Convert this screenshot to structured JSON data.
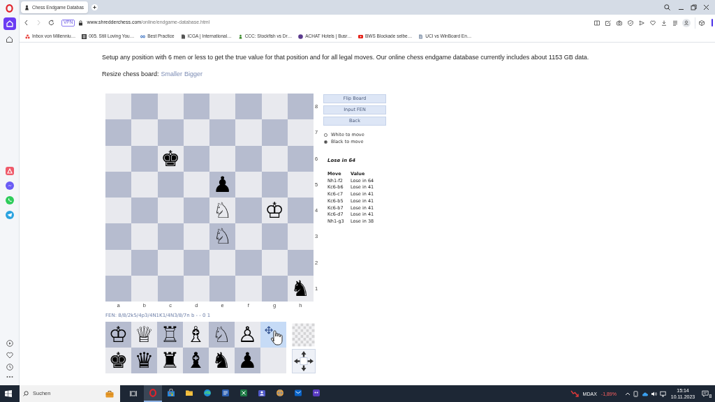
{
  "browser": {
    "tabs": [
      {
        "title": "Chess Endgame Databas",
        "selected": true
      }
    ],
    "address_bar": {
      "vpn_badge": "VPN",
      "url_host": "www.shredderchess.com",
      "url_path": "/online/endgame-database.html"
    },
    "bookmarks": [
      "Inbox von Millenniu…",
      "005. Still Loving You…",
      "Best Practice",
      "ICGA | International…",
      "CCC: Stockfish vs Dr…",
      "ACHAT Hotels | Busr…",
      "BWS Blockade selbe…",
      "UCI vs WinBoard En…"
    ]
  },
  "page": {
    "intro": "Setup any position with 6 men or less to get the true value for that position and for all legal moves. Our online chess endgame database currently includes about 1153 GB data.",
    "resize_label": "Resize chess board:",
    "resize_links": [
      "Smaller",
      "Bigger"
    ],
    "board": {
      "rows": [
        [
          null,
          null,
          null,
          null,
          null,
          null,
          null,
          null
        ],
        [
          null,
          null,
          null,
          null,
          null,
          null,
          null,
          null
        ],
        [
          null,
          null,
          {
            "piece": "♚"
          },
          null,
          null,
          null,
          null,
          null
        ],
        [
          null,
          null,
          null,
          null,
          {
            "piece": "♟"
          },
          null,
          null,
          null
        ],
        [
          null,
          null,
          null,
          null,
          {
            "piece": "♘"
          },
          null,
          {
            "piece": "♔"
          },
          null
        ],
        [
          null,
          null,
          null,
          null,
          {
            "piece": "♘"
          },
          null,
          null,
          null
        ],
        [
          null,
          null,
          null,
          null,
          null,
          null,
          null,
          null
        ],
        [
          null,
          null,
          null,
          null,
          null,
          null,
          null,
          {
            "piece": "♞"
          }
        ]
      ],
      "rank_labels": [
        "8",
        "7",
        "6",
        "5",
        "4",
        "3",
        "2",
        "1"
      ],
      "file_labels": [
        "a",
        "b",
        "c",
        "d",
        "e",
        "f",
        "g",
        "h"
      ]
    },
    "buttons": [
      "Flip Board",
      "Input FEN",
      "Back"
    ],
    "side_to_move": [
      {
        "label": "White to move",
        "selected": false
      },
      {
        "label": "Black to move",
        "selected": true
      }
    ],
    "result": "Lose in 64",
    "moves_table": {
      "columns": [
        "Move",
        "Value"
      ],
      "rows": [
        {
          "move": "Nh1-f2",
          "value": "Lose in 64"
        },
        {
          "move": "Kc6-b6",
          "value": "Lose in 41"
        },
        {
          "move": "Kc6-c7",
          "value": "Lose in 41"
        },
        {
          "move": "Kc6-b5",
          "value": "Lose in 41"
        },
        {
          "move": "Kc6-b7",
          "value": "Lose in 41"
        },
        {
          "move": "Kc6-d7",
          "value": "Lose in 41"
        },
        {
          "move": "Nh1-g3",
          "value": "Lose in 38"
        }
      ]
    },
    "fen": "FEN: 8/8/2k5/4p3/4N1K1/4N3/8/7n b - - 0 1",
    "palette": [
      [
        {
          "kind": "piece",
          "piece": "♔",
          "selected": false
        },
        {
          "kind": "piece",
          "piece": "♕",
          "selected": false
        },
        {
          "kind": "piece",
          "piece": "♖",
          "selected": false
        },
        {
          "kind": "piece",
          "piece": "♗",
          "selected": false
        },
        {
          "kind": "piece",
          "piece": "♘",
          "selected": false
        },
        {
          "kind": "piece",
          "piece": "♙",
          "selected": false
        },
        {
          "kind": "move-tool",
          "selected": true
        }
      ],
      [
        {
          "kind": "piece",
          "piece": "♚",
          "selected": false
        },
        {
          "kind": "piece",
          "piece": "♛",
          "selected": false
        },
        {
          "kind": "piece",
          "piece": "♜",
          "selected": false
        },
        {
          "kind": "piece",
          "piece": "♝",
          "selected": false
        },
        {
          "kind": "piece",
          "piece": "♞",
          "selected": false
        },
        {
          "kind": "piece",
          "piece": "♟",
          "selected": false
        },
        {
          "kind": "blank",
          "selected": false
        }
      ]
    ]
  },
  "taskbar": {
    "search_placeholder": "Suchen",
    "apps": [
      {
        "selected": true
      },
      {
        "selected": false
      },
      {
        "selected": false
      },
      {
        "selected": false
      },
      {
        "selected": false
      },
      {
        "selected": false
      },
      {
        "selected": false
      },
      {
        "selected": false
      },
      {
        "selected": false
      },
      {
        "selected": false
      }
    ],
    "ticker": {
      "name": "MDAX",
      "change": "-1,89%"
    },
    "time": "15:14",
    "date": "10.11.2023",
    "notification_count": "8"
  }
}
